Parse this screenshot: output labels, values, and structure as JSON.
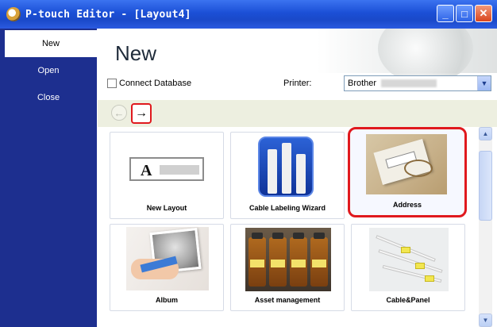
{
  "window": {
    "title": "P-touch Editor - [Layout4]",
    "minimize_icon": "minimize-icon",
    "maximize_icon": "maximize-icon",
    "close_icon": "close-icon"
  },
  "sidebar": {
    "items": [
      {
        "label": "New",
        "active": true
      },
      {
        "label": "Open",
        "active": false
      },
      {
        "label": "Close",
        "active": false
      }
    ]
  },
  "main": {
    "title": "New",
    "connect_database_label": "Connect Database",
    "printer_label": "Printer:",
    "printer_value": "Brother",
    "nav": {
      "back_icon": "arrow-left-icon",
      "forward_icon": "arrow-right-icon"
    },
    "tiles": [
      {
        "label": "New Layout",
        "selected": false
      },
      {
        "label": "Cable Labeling Wizard",
        "selected": false
      },
      {
        "label": "Address",
        "selected": true
      },
      {
        "label": "Album",
        "selected": false
      },
      {
        "label": "Asset management",
        "selected": false
      },
      {
        "label": "Cable&Panel",
        "selected": false
      }
    ]
  },
  "colors": {
    "sidebar_bg": "#1d2f8f",
    "highlight_red": "#e0191e",
    "titlebar_blue": "#1b4fd6"
  }
}
